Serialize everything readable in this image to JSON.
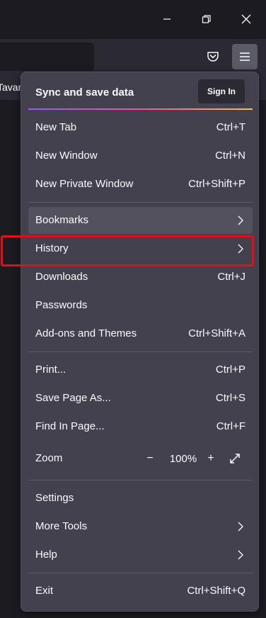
{
  "colors": {
    "chrome_dark": "#1c1b22",
    "toolbar": "#2b2a33",
    "panel_bg": "#42414d",
    "hover": "#52525e",
    "text": "#fbfbfe",
    "highlight_red": "#e0101a"
  },
  "window_controls": {
    "minimize_icon": "minimize-icon",
    "restore_icon": "restore-icon",
    "close_icon": "close-icon"
  },
  "toolbar": {
    "pocket_icon": "pocket-icon",
    "menu_icon": "hamburger-menu-icon"
  },
  "bookmarks_bar": {
    "item_label": "Tavan"
  },
  "menu": {
    "sync_title": "Sync and save data",
    "sign_in_label": "Sign In",
    "items": [
      {
        "label": "New Tab",
        "shortcut": "Ctrl+T"
      },
      {
        "label": "New Window",
        "shortcut": "Ctrl+N"
      },
      {
        "label": "New Private Window",
        "shortcut": "Ctrl+Shift+P"
      },
      {
        "label": "Bookmarks",
        "shortcut": ""
      },
      {
        "label": "History",
        "shortcut": ""
      },
      {
        "label": "Downloads",
        "shortcut": "Ctrl+J"
      },
      {
        "label": "Passwords",
        "shortcut": ""
      },
      {
        "label": "Add-ons and Themes",
        "shortcut": "Ctrl+Shift+A"
      },
      {
        "label": "Print...",
        "shortcut": "Ctrl+P"
      },
      {
        "label": "Save Page As...",
        "shortcut": "Ctrl+S"
      },
      {
        "label": "Find In Page...",
        "shortcut": "Ctrl+F"
      },
      {
        "label": "Settings",
        "shortcut": ""
      },
      {
        "label": "More Tools",
        "shortcut": ""
      },
      {
        "label": "Help",
        "shortcut": ""
      },
      {
        "label": "Exit",
        "shortcut": "Ctrl+Shift+Q"
      }
    ],
    "zoom": {
      "label": "Zoom",
      "minus": "−",
      "value": "100%",
      "plus": "+",
      "fullscreen_icon": "fullscreen-icon"
    }
  }
}
